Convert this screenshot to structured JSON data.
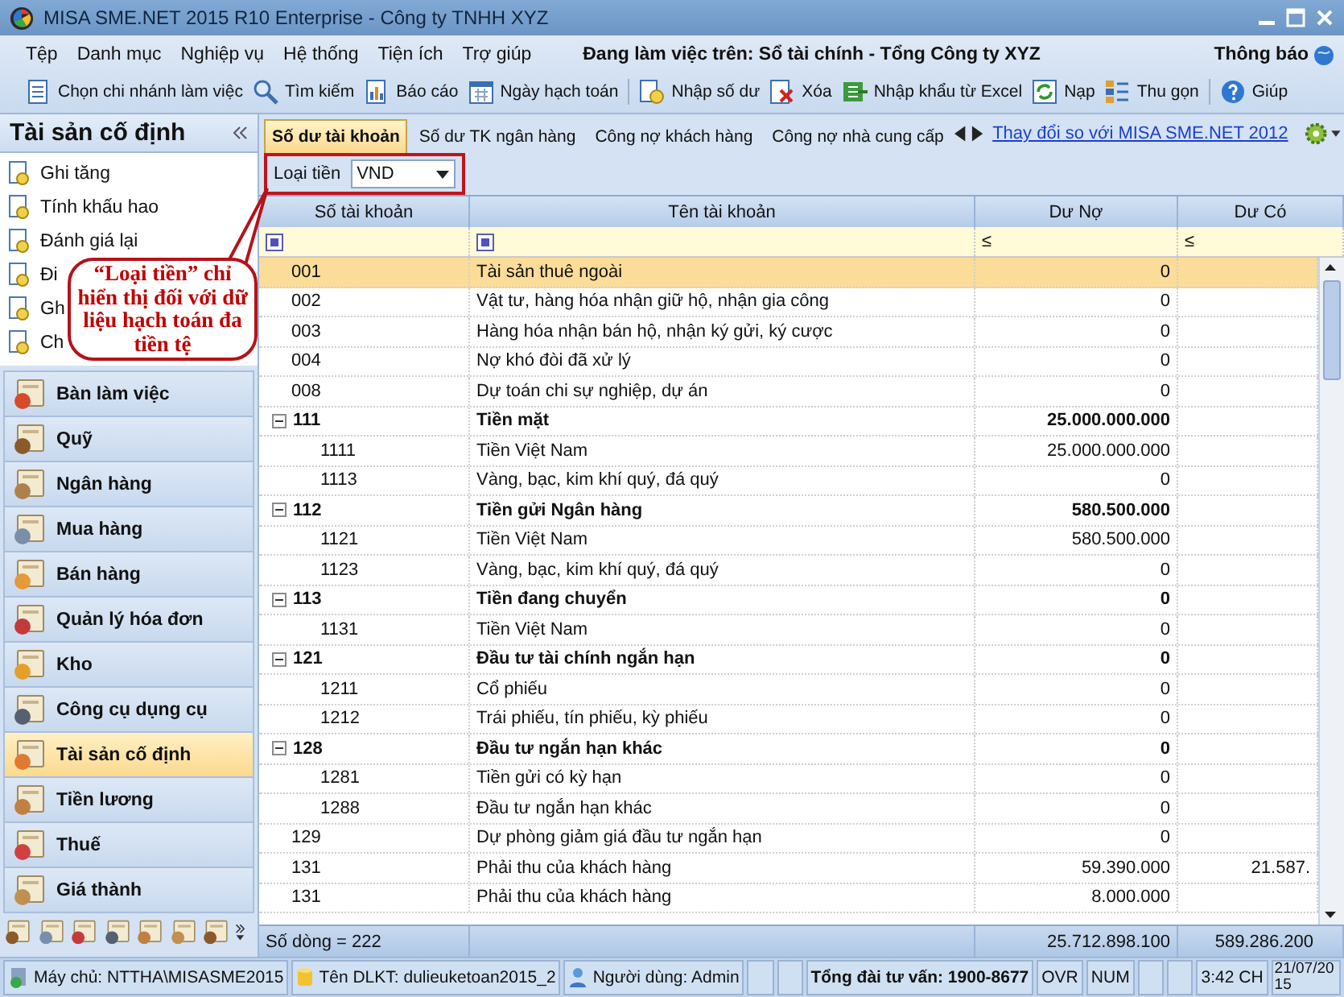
{
  "window": {
    "title": "MISA SME.NET 2015 R10 Enterprise - Công ty TNHH XYZ"
  },
  "menu": [
    "Tệp",
    "Danh mục",
    "Nghiệp vụ",
    "Hệ thống",
    "Tiện ích",
    "Trợ giúp"
  ],
  "working_on": "Đang làm việc trên: Sổ tài chính - Tổng Công ty XYZ",
  "notifications": "Thông báo",
  "toolbar": [
    [
      "Chọn chi nhánh làm việc",
      "Tìm kiếm",
      "Báo cáo",
      "Ngày hạch toán"
    ],
    [
      "Nhập số dư",
      "Xóa",
      "Nhập khẩu từ Excel",
      "Nạp",
      "Thu gọn"
    ],
    [
      "Giúp"
    ]
  ],
  "sidebar": {
    "title": "Tài sản cố định",
    "items": [
      "Ghi tăng",
      "Tính khấu hao",
      "Đánh giá lại",
      "Đi",
      "Gh",
      "Ch"
    ],
    "modules": [
      {
        "label": "Bàn làm việc",
        "selected": false
      },
      {
        "label": "Quỹ",
        "selected": false
      },
      {
        "label": "Ngân hàng",
        "selected": false
      },
      {
        "label": "Mua hàng",
        "selected": false
      },
      {
        "label": "Bán hàng",
        "selected": false
      },
      {
        "label": "Quản lý hóa đơn",
        "selected": false
      },
      {
        "label": "Kho",
        "selected": false
      },
      {
        "label": "Công cụ dụng cụ",
        "selected": false
      },
      {
        "label": "Tài sản cố định",
        "selected": true
      },
      {
        "label": "Tiền lương",
        "selected": false
      },
      {
        "label": "Thuế",
        "selected": false
      },
      {
        "label": "Giá thành",
        "selected": false
      }
    ]
  },
  "tabs": [
    {
      "label": "Số dư tài khoản",
      "selected": true
    },
    {
      "label": "Số dư TK ngân hàng",
      "selected": false
    },
    {
      "label": "Công nợ khách hàng",
      "selected": false
    },
    {
      "label": "Công nợ nhà cung cấp",
      "selected": false
    }
  ],
  "compare_link": "Thay đổi so với MISA SME.NET 2012",
  "currency": {
    "label": "Loại tiền",
    "value": "VND"
  },
  "callout": "“Loại tiền” chỉ hiển thị đối với dữ liệu hạch toán đa tiền tệ",
  "table": {
    "columns": [
      {
        "title": "Số tài khoản"
      },
      {
        "title": "Tên tài khoản"
      },
      {
        "title": "Dư Nợ",
        "filter_op": "≤"
      },
      {
        "title": "Dư Có",
        "filter_op": "≤"
      }
    ],
    "rows": [
      {
        "kind": "leaf",
        "code": "001",
        "name": "Tài sản thuê ngoài",
        "debit": "0",
        "selected": true
      },
      {
        "kind": "leaf",
        "code": "002",
        "name": "Vật tư, hàng hóa nhận giữ hộ, nhận gia công",
        "debit": "0",
        "selected": false
      },
      {
        "kind": "leaf",
        "code": "003",
        "name": "Hàng hóa nhận bán hộ, nhận ký gửi, ký cược",
        "debit": "0",
        "selected": false
      },
      {
        "kind": "leaf",
        "code": "004",
        "name": "Nợ khó đòi đã xử lý",
        "debit": "0",
        "selected": false
      },
      {
        "kind": "leaf",
        "code": "008",
        "name": "Dự toán chi sự nghiệp, dự án",
        "debit": "0",
        "selected": false
      },
      {
        "kind": "group",
        "code": "111",
        "name": "Tiền mặt",
        "debit": "25.000.000.000",
        "selected": false,
        "expanded": true,
        "children": [
          {
            "kind": "leaf",
            "code": "1111",
            "name": "Tiền Việt Nam",
            "debit": "25.000.000.000",
            "selected": false
          },
          {
            "kind": "leaf",
            "code": "1113",
            "name": "Vàng, bạc, kim khí quý, đá quý",
            "debit": "0",
            "selected": false
          }
        ]
      },
      {
        "kind": "group",
        "code": "112",
        "name": "Tiền gửi Ngân hàng",
        "debit": "580.500.000",
        "selected": false,
        "expanded": true,
        "children": [
          {
            "kind": "leaf",
            "code": "1121",
            "name": "Tiền Việt Nam",
            "debit": "580.500.000",
            "selected": false
          },
          {
            "kind": "leaf",
            "code": "1123",
            "name": "Vàng, bạc, kim khí quý, đá quý",
            "debit": "0",
            "selected": false
          }
        ]
      },
      {
        "kind": "group",
        "code": "113",
        "name": "Tiền đang chuyển",
        "debit": "0",
        "selected": false,
        "expanded": true,
        "children": [
          {
            "kind": "leaf",
            "code": "1131",
            "name": "Tiền Việt Nam",
            "debit": "0",
            "selected": false
          }
        ]
      },
      {
        "kind": "group",
        "code": "121",
        "name": "Đầu tư tài chính ngắn hạn",
        "debit": "0",
        "selected": false,
        "expanded": true,
        "children": [
          {
            "kind": "leaf",
            "code": "1211",
            "name": "Cổ phiếu",
            "debit": "0",
            "selected": false
          },
          {
            "kind": "leaf",
            "code": "1212",
            "name": "Trái phiếu, tín phiếu, kỳ phiếu",
            "debit": "0",
            "selected": false
          }
        ]
      },
      {
        "kind": "group",
        "code": "128",
        "name": "Đầu tư ngắn hạn khác",
        "debit": "0",
        "selected": false,
        "expanded": true,
        "children": [
          {
            "kind": "leaf",
            "code": "1281",
            "name": "Tiền gửi có kỳ hạn",
            "debit": "0",
            "selected": false
          },
          {
            "kind": "leaf",
            "code": "1288",
            "name": "Đầu tư ngắn hạn khác",
            "debit": "0",
            "selected": false
          }
        ]
      },
      {
        "kind": "leaf",
        "code": "129",
        "name": "Dự phòng giảm giá đầu tư ngắn hạn",
        "debit": "0",
        "selected": false
      },
      {
        "kind": "leaf",
        "code": "131",
        "name": "Phải thu của khách hàng",
        "debit": "59.390.000",
        "credit": "21.587.",
        "selected": false
      },
      {
        "kind": "leaf",
        "code": "131",
        "name": "Phải thu của khách hàng",
        "debit": "8.000.000",
        "selected": false
      }
    ],
    "footer": {
      "count": "Số dòng = 222",
      "debit_total": "25.712.898.100",
      "credit_total": "589.286.200"
    }
  },
  "status_bar": [
    {
      "kind": "server",
      "text": "Máy chủ: NTTHA\\MISASME2015"
    },
    {
      "kind": "database",
      "text": "Tên DLKT: dulieuketoan2015_2"
    },
    {
      "kind": "user",
      "text": "Người dùng: Admin"
    },
    {
      "kind": "blank"
    },
    {
      "kind": "blank"
    },
    {
      "kind": "hotline",
      "text": "Tổng đài tư vấn: 1900-8677"
    },
    {
      "kind": "text",
      "text": "OVR"
    },
    {
      "kind": "text",
      "text": "NUM"
    },
    {
      "kind": "blank"
    },
    {
      "kind": "blank"
    },
    {
      "kind": "text",
      "text": "3:42 CH"
    },
    {
      "kind": "date",
      "text": "21/07/2015"
    }
  ]
}
